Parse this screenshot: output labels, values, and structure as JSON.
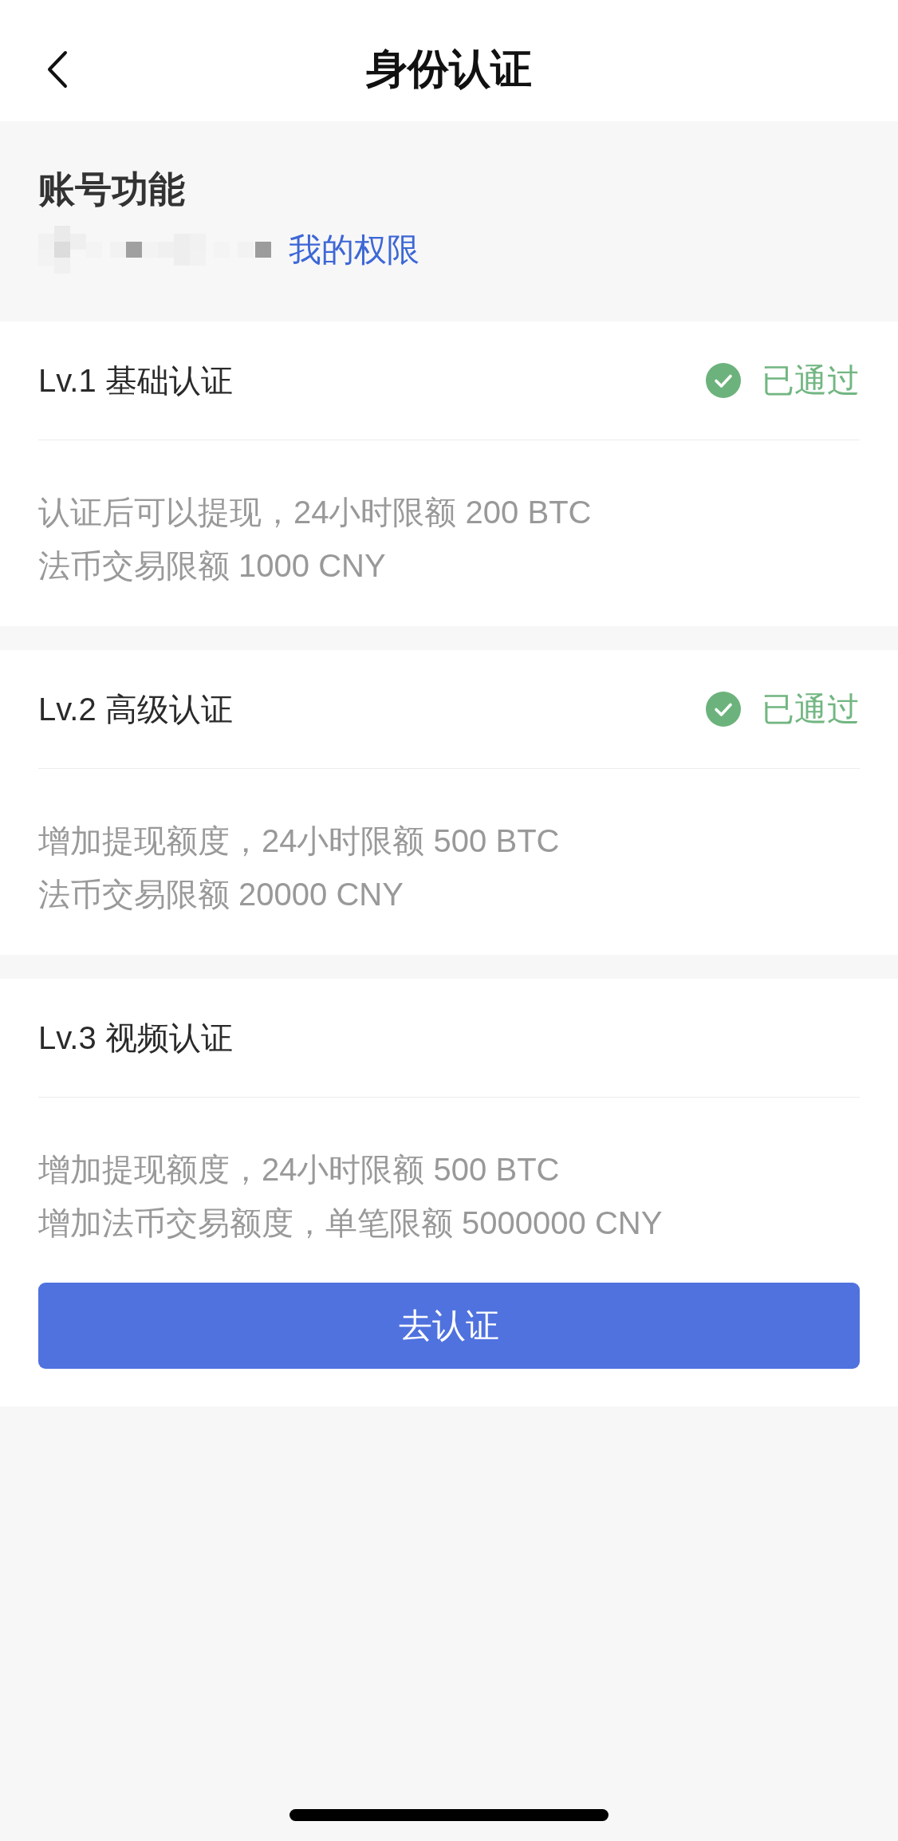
{
  "header": {
    "title": "身份认证"
  },
  "account": {
    "title": "账号功能",
    "id_masked": true,
    "permissions_link": "我的权限"
  },
  "levels": [
    {
      "kind": "status",
      "title": "Lv.1 基础认证",
      "status": {
        "label": "已通过",
        "passed": true
      },
      "lines": [
        "认证后可以提现，24小时限额 200 BTC",
        "法币交易限额 1000 CNY"
      ]
    },
    {
      "kind": "status",
      "title": "Lv.2 高级认证",
      "status": {
        "label": "已通过",
        "passed": true
      },
      "lines": [
        "增加提现额度，24小时限额 500 BTC",
        "法币交易限额 20000 CNY"
      ]
    },
    {
      "kind": "action",
      "title": "Lv.3 视频认证",
      "lines": [
        "增加提现额度，24小时限额 500 BTC",
        "增加法币交易额度，单笔限额 5000000 CNY"
      ],
      "button": "去认证"
    }
  ]
}
